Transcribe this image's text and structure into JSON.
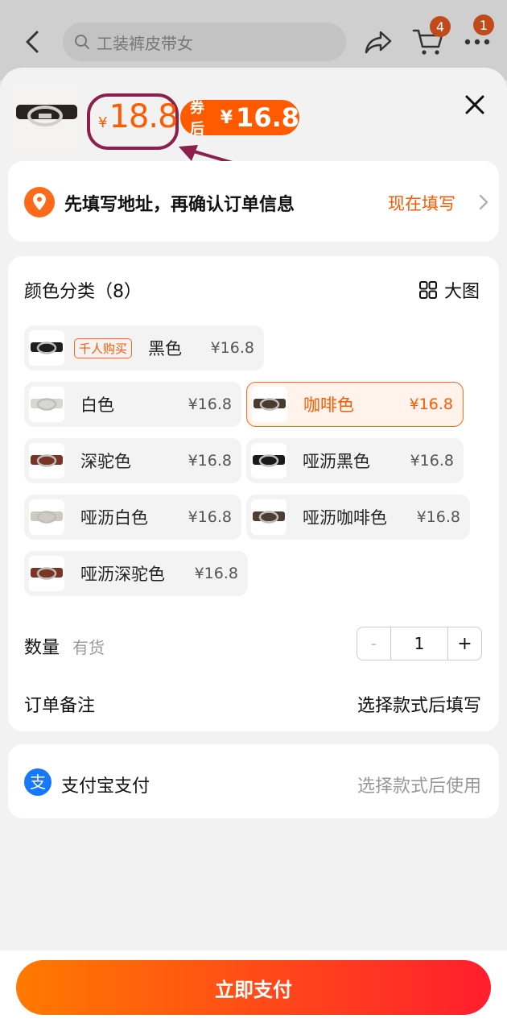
{
  "header": {
    "search_placeholder": "工装裤皮带女",
    "cart_badge": "4",
    "more_badge": "1"
  },
  "product": {
    "price_currency": "¥",
    "price": "18.8",
    "coupon_label": "券后",
    "coupon_currency": "¥",
    "coupon_price": "16.8"
  },
  "address": {
    "text": "先填写地址，再确认订单信息",
    "link": "现在填写"
  },
  "spec": {
    "title": "颜色分类（8）",
    "bigpic_label": "大图",
    "options": [
      {
        "tag": "千人购买",
        "name": "黑色",
        "price": "¥16.8",
        "selected": false,
        "belt_color": "#1e1e1e"
      },
      {
        "name": "白色",
        "price": "¥16.8",
        "selected": false,
        "belt_color": "#d8d6d0"
      },
      {
        "name": "咖啡色",
        "price": "¥16.8",
        "selected": true,
        "belt_color": "#4a3a30"
      },
      {
        "name": "深驼色",
        "price": "¥16.8",
        "selected": false,
        "belt_color": "#7a3424"
      },
      {
        "name": "哑沥黑色",
        "price": "¥16.8",
        "selected": false,
        "belt_color": "#1a1a1a"
      },
      {
        "name": "哑沥白色",
        "price": "¥16.8",
        "selected": false,
        "belt_color": "#cfcabf"
      },
      {
        "name": "哑沥咖啡色",
        "price": "¥16.8",
        "selected": false,
        "belt_color": "#4d3d33"
      },
      {
        "name": "哑沥深驼色",
        "price": "¥16.8",
        "selected": false,
        "belt_color": "#7c3525"
      }
    ]
  },
  "quantity": {
    "label": "数量",
    "stock": "有货",
    "minus": "-",
    "value": "1",
    "plus": "+"
  },
  "note": {
    "label": "订单备注",
    "value": "选择款式后填写"
  },
  "payment": {
    "label": "支付宝支付",
    "value": "选择款式后使用"
  },
  "action": {
    "pay_label": "立即支付"
  },
  "colors": {
    "accent": "#ff5a00",
    "annotation": "#8d1f4c"
  }
}
